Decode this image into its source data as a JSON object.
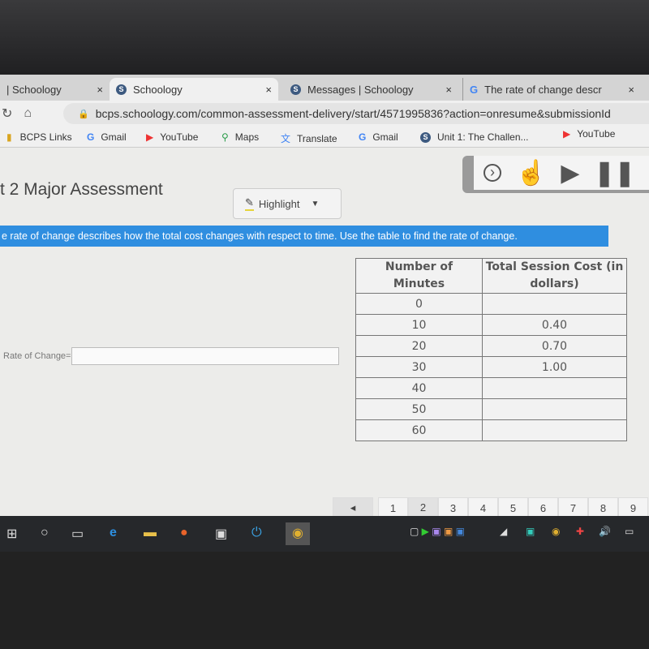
{
  "browser": {
    "tabs": [
      {
        "label": "| Schoology",
        "icon": "schoology-icon"
      },
      {
        "label": "Schoology",
        "icon": "schoology-icon"
      },
      {
        "label": "Messages | Schoology",
        "icon": "schoology-icon"
      },
      {
        "label": "The rate of change descr",
        "icon": "google-icon"
      }
    ],
    "close": "×",
    "url": "bcps.schoology.com/common-assessment-delivery/start/4571995836?action=onresume&submissionId",
    "bookmarks": [
      "BCPS Links",
      "Gmail",
      "YouTube",
      "Maps",
      "Translate",
      "Gmail",
      "Unit 1: The Challen...",
      "YouTube"
    ]
  },
  "page": {
    "title": "t 2 Major Assessment",
    "highlight_label": "Highlight",
    "prompt": "e rate of change describes how the total cost changes with respect to time. Use the table to find the rate of change.",
    "rate_label": "Rate of Change=",
    "rate_value": ""
  },
  "table": {
    "headers": [
      "Number of Minutes",
      "Total Session Cost (in dollars)"
    ],
    "rows": [
      [
        "0",
        ""
      ],
      [
        "10",
        "0.40"
      ],
      [
        "20",
        "0.70"
      ],
      [
        "30",
        "1.00"
      ],
      [
        "40",
        ""
      ],
      [
        "50",
        ""
      ],
      [
        "60",
        ""
      ]
    ]
  },
  "pager": {
    "prev": "◂",
    "pages": [
      "1",
      "2",
      "3",
      "4",
      "5",
      "6",
      "7",
      "8",
      "9"
    ],
    "current": "2"
  },
  "colors": {
    "accent": "#2f8ee0"
  }
}
